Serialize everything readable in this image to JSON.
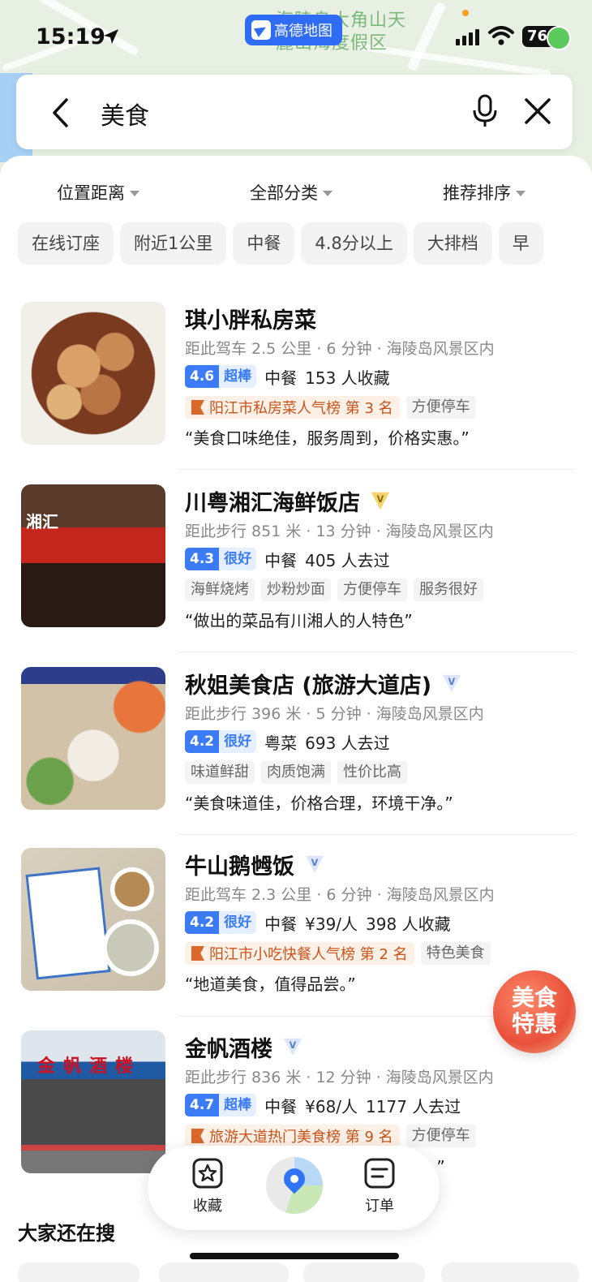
{
  "status_bar": {
    "time": "15:19",
    "app_badge": "高德地图",
    "battery": "76"
  },
  "map": {
    "label_line1": "海陵岛大角山天",
    "label_line2": "麓山海度假区"
  },
  "search": {
    "query": "美食"
  },
  "filters": [
    "位置距离",
    "全部分类",
    "推荐排序"
  ],
  "chips": [
    "在线订座",
    "附近1公里",
    "中餐",
    "4.8分以上",
    "大排档",
    "早"
  ],
  "results": [
    {
      "name": "琪小胖私房菜",
      "badge": "",
      "distance": "距此驾车 2.5 公里 · 6 分钟 · 海陵岛风景区内",
      "score": "4.6",
      "level": "超棒",
      "category": "中餐",
      "price": "",
      "stat": "153 人收藏",
      "rank": "阳江市私房菜人气榜 第 3 名",
      "tags": [
        "方便停车"
      ],
      "quote": "“美食口味绝佳，服务周到，价格实惠。”"
    },
    {
      "name": "川粤湘汇海鲜饭店",
      "badge": "gold-v",
      "distance": "距此步行 851 米 · 13 分钟 · 海陵岛风景区内",
      "score": "4.3",
      "level": "很好",
      "category": "中餐",
      "price": "",
      "stat": "405 人去过",
      "rank": "",
      "tags": [
        "海鲜烧烤",
        "炒粉炒面",
        "方便停车",
        "服务很好"
      ],
      "quote": "“做出的菜品有川湘人的人特色”",
      "thumb_sign": "湘汇"
    },
    {
      "name": "秋姐美食店 (旅游大道店)",
      "badge": "blue-v",
      "distance": "距此步行 396 米 · 5 分钟 · 海陵岛风景区内",
      "score": "4.2",
      "level": "很好",
      "category": "粤菜",
      "price": "",
      "stat": "693 人去过",
      "rank": "",
      "tags": [
        "味道鲜甜",
        "肉质饱满",
        "性价比高"
      ],
      "quote": "“美食味道佳，价格合理，环境干净。”"
    },
    {
      "name": "牛山鹅乸饭",
      "badge": "blue-v",
      "distance": "距此驾车 2.3 公里 · 6 分钟 · 海陵岛风景区内",
      "score": "4.2",
      "level": "很好",
      "category": "中餐",
      "price": "¥39/人",
      "stat": "398 人收藏",
      "rank": "阳江市小吃快餐人气榜 第 2 名",
      "tags": [
        "特色美食"
      ],
      "quote": "“地道美食，值得品尝。”"
    },
    {
      "name": "金帆酒楼",
      "badge": "blue-v",
      "distance": "距此步行 836 米 · 12 分钟 · 海陵岛风景区内",
      "score": "4.7",
      "level": "超棒",
      "category": "中餐",
      "price": "¥68/人",
      "stat": "1177 人去过",
      "rank": "旅游大道热门美食榜 第 9 名",
      "tags": [
        "方便停车"
      ],
      "quote": "“…口。”",
      "thumb_sign": "金帆酒楼"
    }
  ],
  "promo": {
    "line1": "美食",
    "line2": "特惠"
  },
  "bottom_nav": {
    "favorites": "收藏",
    "orders": "订单"
  },
  "section_title": "大家还在搜",
  "colors": {
    "accent": "#3b7bf6",
    "rank_text": "#c8541c",
    "amap_blue": "#2f6cf6"
  }
}
